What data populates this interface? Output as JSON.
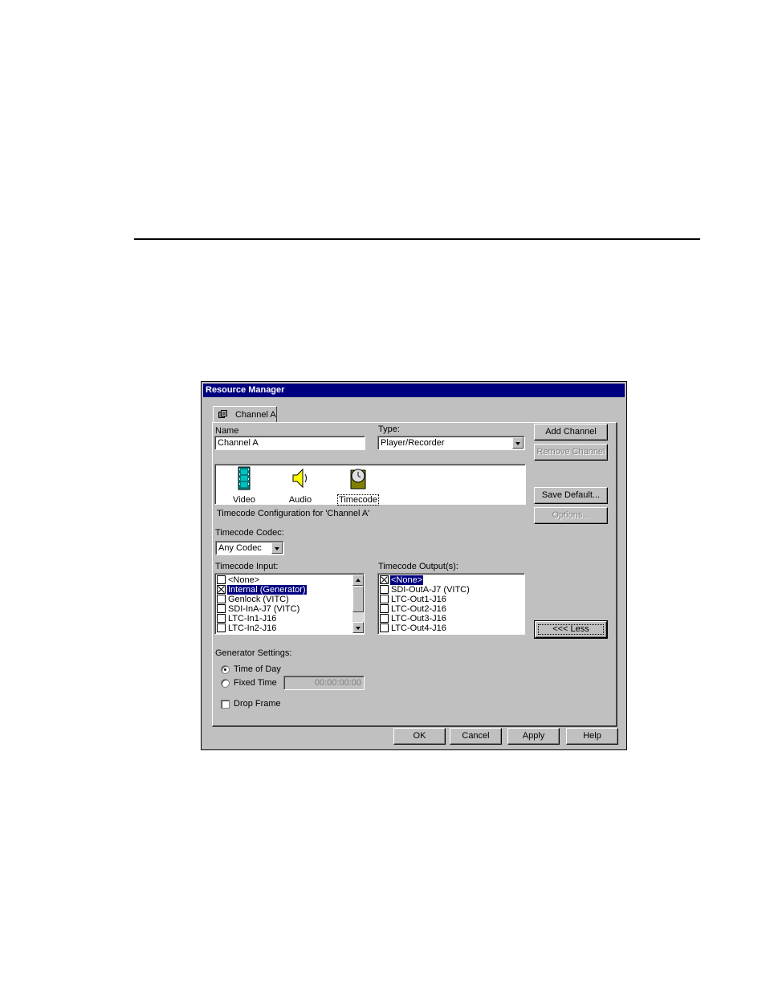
{
  "window": {
    "title": "Resource Manager"
  },
  "tab": {
    "label": "Channel A"
  },
  "name_field": {
    "label": "Name",
    "value": "Channel A"
  },
  "type_field": {
    "label": "Type:",
    "value": "Player/Recorder"
  },
  "resource_icons": [
    {
      "label": "Video",
      "icon": "film-strip-icon"
    },
    {
      "label": "Audio",
      "icon": "speaker-icon"
    },
    {
      "label": "Timecode",
      "icon": "clock-icon"
    }
  ],
  "config_caption": "Timecode Configuration for 'Channel A'",
  "codec": {
    "label": "Timecode Codec:",
    "value": "Any Codec"
  },
  "timecode_input": {
    "label": "Timecode Input:",
    "items": [
      {
        "label": "<None>",
        "checked": false,
        "selected": false
      },
      {
        "label": "Internal (Generator)",
        "checked": true,
        "selected": true
      },
      {
        "label": "Genlock (VITC)",
        "checked": false,
        "selected": false
      },
      {
        "label": "SDI-InA-J7 (VITC)",
        "checked": false,
        "selected": false
      },
      {
        "label": "LTC-In1-J16",
        "checked": false,
        "selected": false
      },
      {
        "label": "LTC-In2-J16",
        "checked": false,
        "selected": false
      }
    ]
  },
  "timecode_output": {
    "label": "Timecode Output(s):",
    "items": [
      {
        "label": "<None>",
        "checked": true,
        "selected": true
      },
      {
        "label": "SDI-OutA-J7 (VITC)",
        "checked": false,
        "selected": false
      },
      {
        "label": "LTC-Out1-J16",
        "checked": false,
        "selected": false
      },
      {
        "label": "LTC-Out2-J16",
        "checked": false,
        "selected": false
      },
      {
        "label": "LTC-Out3-J16",
        "checked": false,
        "selected": false
      },
      {
        "label": "LTC-Out4-J16",
        "checked": false,
        "selected": false
      }
    ]
  },
  "generator": {
    "label": "Generator Settings:",
    "time_of_day": "Time of Day",
    "fixed_time": "Fixed Time",
    "fixed_time_value": "00:00:00:00",
    "selected": "time_of_day",
    "drop_frame": "Drop Frame"
  },
  "side_buttons": {
    "add_channel": "Add Channel",
    "remove_channel": "Remove Channel",
    "save_default": "Save Default...",
    "options": "Options...",
    "less": "<<< Less"
  },
  "footer_buttons": {
    "ok": "OK",
    "cancel": "Cancel",
    "apply": "Apply",
    "help": "Help"
  },
  "colors": {
    "title_bar": "#000080",
    "dialog_face": "#c0c0c0",
    "selection": "#000080"
  }
}
